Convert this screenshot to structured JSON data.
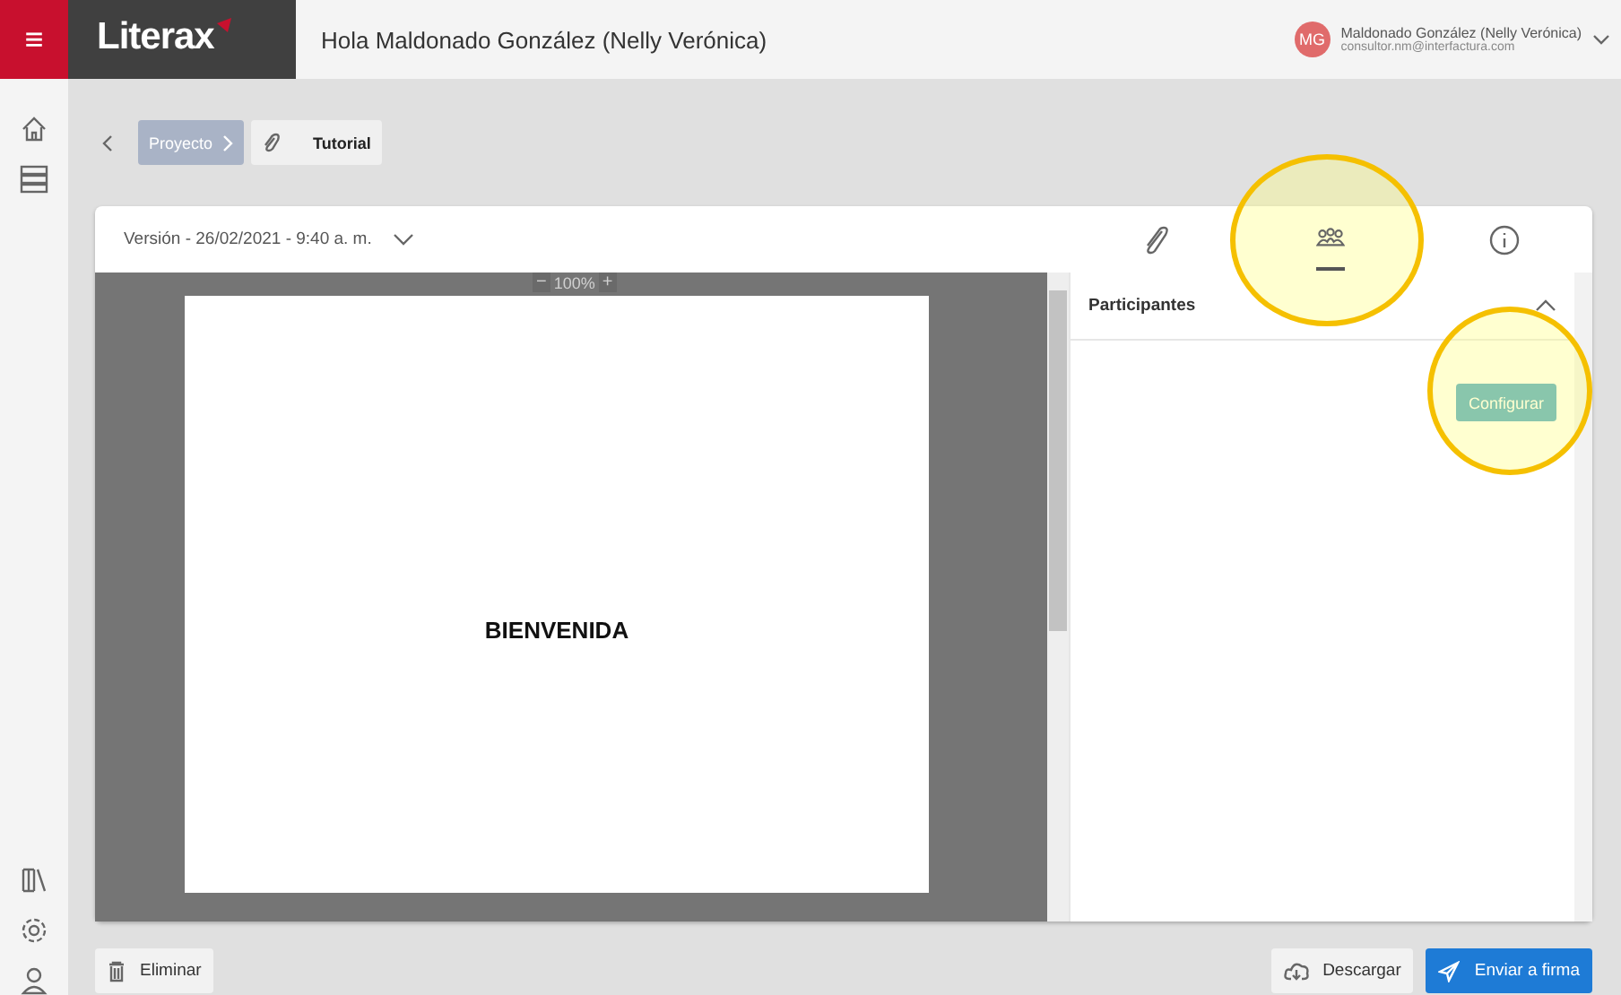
{
  "header": {
    "menu_icon": "≡",
    "logo": "Literax",
    "greeting": "Hola Maldonado González (Nelly Verónica)",
    "user": {
      "initials": "MG",
      "name": "Maldonado González (Nelly Verónica)",
      "email": "consultor.nm@interfactura.com"
    }
  },
  "breadcrumb": [
    {
      "label": "Proyecto",
      "kind": "folder"
    },
    {
      "label": "Tutorial",
      "kind": "file"
    }
  ],
  "version": "Versión - 26/02/2021 - 9:40 a. m.",
  "tabs": [
    {
      "kind": "attachments",
      "selected": false
    },
    {
      "kind": "participants",
      "selected": true
    },
    {
      "kind": "info",
      "selected": false
    }
  ],
  "viewer": {
    "zoom_out": "−",
    "zoom": "100%",
    "zoom_in": "+",
    "page_text": "BIENVENIDA"
  },
  "panel": {
    "title": "Participantes",
    "expanded": true,
    "button": "Configurar"
  },
  "actions": {
    "delete": "Eliminar",
    "download": "Descargar",
    "send": "Enviar a firma"
  }
}
